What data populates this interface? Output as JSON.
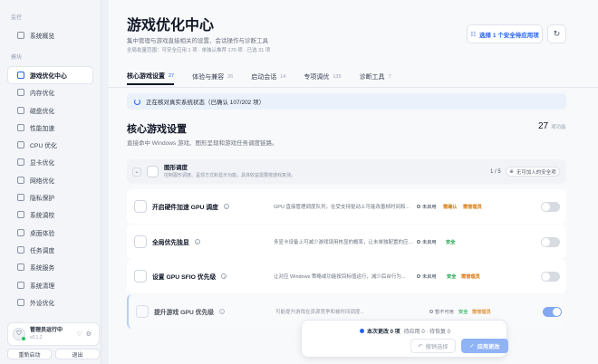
{
  "sidebar": {
    "section_system": "监控",
    "item_overview": "系统概览",
    "section_modules": "模块",
    "items": [
      "游戏优化中心",
      "内存优化",
      "磁盘优化",
      "性能加速",
      "CPU 优化",
      "显卡优化",
      "网络优化",
      "隐私保护",
      "系统调校",
      "桌面体验",
      "任务调度",
      "系统服务",
      "系统清理",
      "外设优化"
    ],
    "user_name": "管理员运行中",
    "user_version": "v0.1.2",
    "restart_label": "重新启动",
    "exit_label": "退出"
  },
  "header": {
    "title": "游戏优化中心",
    "subtitle": "集中管理与游戏直接相关的设置、会话操作与诊断工具",
    "summary": "全局批量范围：可安全应用 1 项 · 单独认推荐 170 项 · 已选 31 项",
    "select_button": "选择 1 个安全待应用项"
  },
  "tabs": [
    {
      "label": "核心游戏设置",
      "count": "27"
    },
    {
      "label": "体验与兼容",
      "count": "26"
    },
    {
      "label": "启动会话",
      "count": "14"
    },
    {
      "label": "专项调优",
      "count": "135"
    },
    {
      "label": "诊断工具",
      "count": "7"
    }
  ],
  "status_text": "正在核对真实系统状态（已确认 107/202 项）",
  "section": {
    "title": "核心游戏设置",
    "desc": "直接命中 Windows 游戏、图形呈现和游戏任务调度链路。",
    "count": "27",
    "count_unit": "项功能"
  },
  "group": {
    "title": "图形调度",
    "desc": "控制图形调度、呈现方式和显示功能，具体收益需要按游戏复测。",
    "count": "1 / 5",
    "add_label": "无可加入的安全项"
  },
  "rows": [
    {
      "name": "开启硬件加速 GPU 调度",
      "desc": "GPU 直接管理调度队列，在受支持驱动上可能改善帧时间和...",
      "state": "未启用",
      "tag1": "需确认",
      "tag2": "需管理员",
      "tag1_color": "#d97706",
      "tag2_color": "#d97706"
    },
    {
      "name": "全局优先独显",
      "desc": "多显卡设备上可减少游戏误用核显的概率，让未单独配置的应用更倾向使...",
      "state": "未启用",
      "tag1": "安全",
      "tag2": "",
      "tag1_color": "#16a34a",
      "tag2_color": ""
    },
    {
      "name": "设置 GPU SFIO 优先级",
      "desc": "让对应 Windows 策略或功能按目标值运行，减少后台行为...",
      "state": "未启用",
      "tag1": "安全",
      "tag2": "需管理员",
      "tag1_color": "#16a34a",
      "tag2_color": "#d97706"
    },
    {
      "name": "提升游戏 GPU 优先级",
      "desc": "可能提升游戏在资源竞争和被时间调度...",
      "state": "暂不可用",
      "tag1": "安全",
      "tag2": "需管理员",
      "tag1_color": "#16a34a",
      "tag2_color": "#d97706"
    }
  ],
  "bottom": {
    "changes_label": "本次更改 0 项",
    "pending": "待应用 0 · 待恢复 0",
    "undo_label": "撤销选择",
    "apply_label": "应用更改"
  }
}
